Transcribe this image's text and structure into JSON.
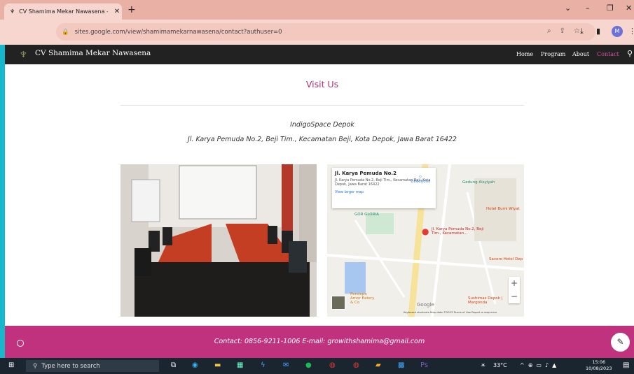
{
  "browser": {
    "tab_title": "CV Shamima Mekar Nawasena -",
    "tab_close": "✕",
    "new_tab": "+",
    "url": "sites.google.com/view/shamimamekarnawasena/contact?authuser=0",
    "profile_initial": "M"
  },
  "site": {
    "name": "CV Shamima Mekar Nawasena",
    "menu": [
      "Home",
      "Program",
      "About",
      "Contact"
    ],
    "active_menu": "Contact"
  },
  "main": {
    "title": "Visit Us",
    "venue": "IndigoSpace Depok",
    "address": "Jl. Karya Pemuda No.2, Beji Tim., Kecamatan Beji, Kota Depok, Jawa Barat 16422"
  },
  "map": {
    "card_title": "Jl. Karya Pemuda No.2",
    "card_address": "Jl. Karya Pemuda No.2, Beji Tim., Kecamatan Beji, Kota Depok, Jawa Barat 16422",
    "directions": "Directions",
    "view_larger": "View larger map",
    "labels": [
      "Gedung Aisyiyah",
      "GOR GLORIA",
      "Jl. Karya Pemuda No.2, Beji Tim., Kecamatan...",
      "Hotel Bumi Wiyat",
      "Savero Hotel Dep",
      "Pendopo Amor Eatery & Co",
      "Sushimas Depok | Margonda",
      "Google"
    ],
    "attribution": "Keyboard shortcuts   Map data ©2023   Terms of Use   Report a map error"
  },
  "footer": {
    "contact": "Contact: 0856-9211-1006 E-mail: growithshamima@gmail.com"
  },
  "taskbar": {
    "search_placeholder": "Type here to search",
    "weather": "33°C",
    "time": "15:06",
    "date": "10/08/2023"
  },
  "colors": {
    "accent": "#c0327e",
    "tab_bar": "#e9b1a6",
    "site_bar": "#222222"
  }
}
